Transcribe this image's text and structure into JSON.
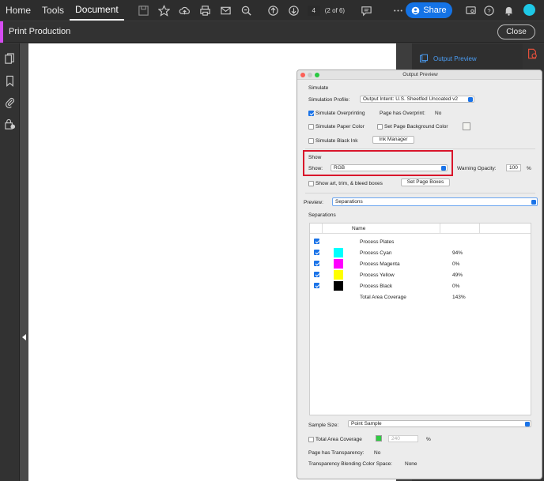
{
  "menu": {
    "home": "Home",
    "tools": "Tools",
    "document": "Document"
  },
  "toolbar": {
    "page_number": "4",
    "page_of": "(2 of 6)",
    "share_label": "Share"
  },
  "production": {
    "title": "Print Production",
    "close_label": "Close"
  },
  "right_panel": {
    "output_preview_label": "Output Preview"
  },
  "dialog": {
    "title": "Output Preview",
    "simulate": {
      "heading": "Simulate",
      "profile_label": "Simulation Profile:",
      "profile_value": "Output Intent: U.S. Sheetfed Uncoated v2",
      "overprinting_label": "Simulate Overprinting",
      "overprinting_checked": true,
      "has_overprint_label": "Page has Overprint:",
      "has_overprint_value": "No",
      "paper_color_label": "Simulate Paper Color",
      "page_bg_label": "Set Page Background Color",
      "black_ink_label": "Simulate Black Ink",
      "ink_manager_label": "Ink Manager"
    },
    "show": {
      "heading": "Show",
      "show_label": "Show:",
      "show_value": "RGB",
      "warning_label": "Warning Opacity:",
      "warning_value": "100",
      "warning_unit": "%",
      "art_trim_label": "Show art, trim, & bleed boxes",
      "page_boxes_label": "Set Page Boxes"
    },
    "preview": {
      "label": "Preview:",
      "value": "Separations"
    },
    "separations": {
      "heading": "Separations",
      "col_name": "Name",
      "rows": [
        {
          "name": "Process Plates",
          "value": "",
          "checked": true,
          "color": ""
        },
        {
          "name": "Process Cyan",
          "value": "94%",
          "checked": true,
          "color": "#00ffff"
        },
        {
          "name": "Process Magenta",
          "value": "0%",
          "checked": true,
          "color": "#ff00ff"
        },
        {
          "name": "Process Yellow",
          "value": "49%",
          "checked": true,
          "color": "#ffff00"
        },
        {
          "name": "Process Black",
          "value": "0%",
          "checked": true,
          "color": "#000000"
        },
        {
          "name": "Total Area Coverage",
          "value": "143%",
          "checked": false,
          "color": ""
        }
      ]
    },
    "sample_size": {
      "label": "Sample Size:",
      "value": "Point Sample"
    },
    "total_coverage": {
      "label": "Total Area Coverage",
      "value": "240",
      "unit": "%",
      "swatch_color": "#2ecc40"
    },
    "transparency": {
      "label": "Page has Transparency:",
      "value": "No"
    },
    "blending": {
      "label": "Transparency Blending Color Space:",
      "value": "None"
    }
  }
}
